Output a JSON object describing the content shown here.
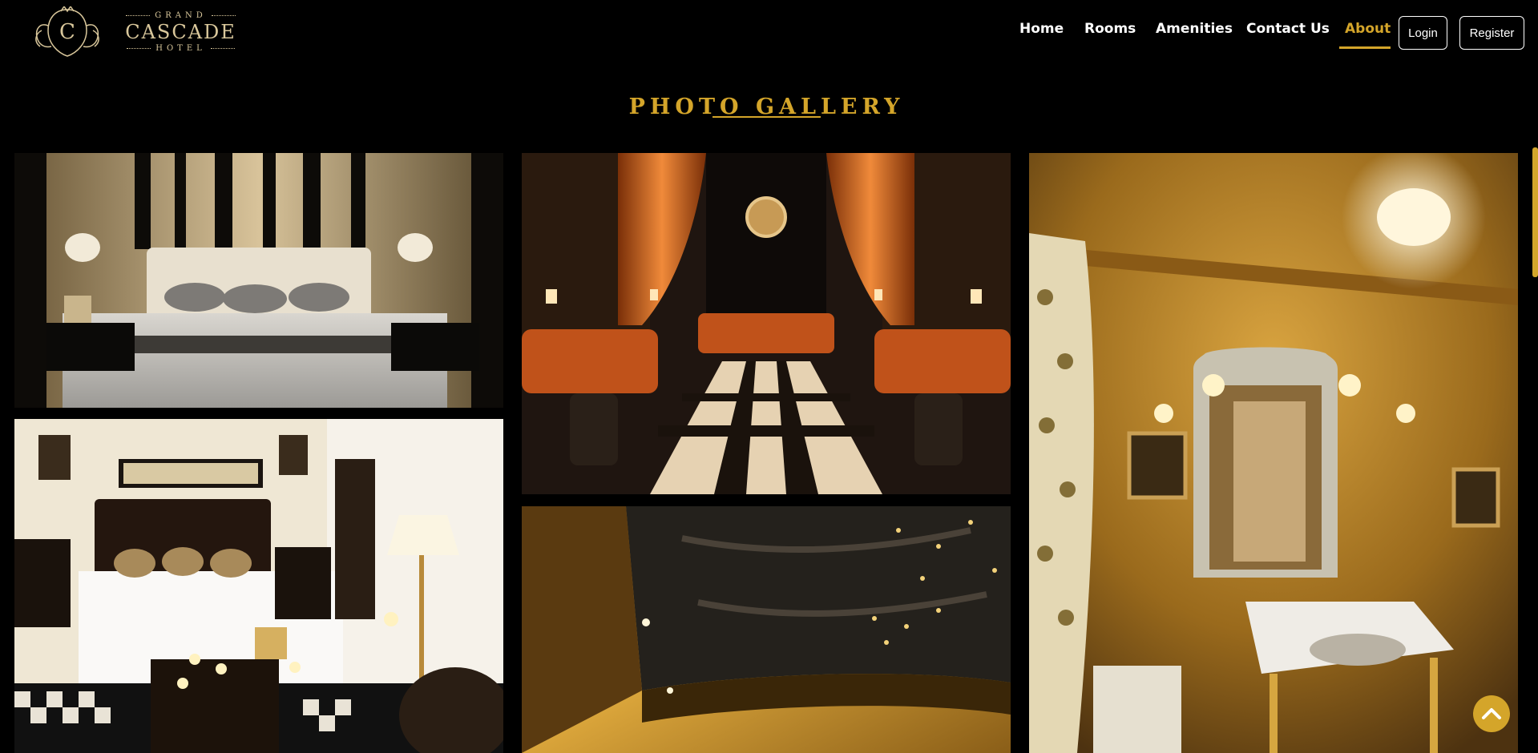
{
  "brand": {
    "top_line": "GRAND",
    "name": "CASCADE",
    "bottom_line": "HOTEL",
    "monogram": "C",
    "accent_color": "#d4a52a"
  },
  "nav": {
    "home": "Home",
    "rooms": "Rooms",
    "amenities": "Amenities",
    "contact": "Contact Us",
    "about": "About",
    "active": "About",
    "login": "Login",
    "register": "Register"
  },
  "gallery": {
    "title": "PHOTO GALLERY",
    "photos": [
      {
        "subject": "Suite bedroom with tufted headboard and striped gold wall"
      },
      {
        "subject": "Lobby lounge with orange drapes, zebra chairs and spiral staircase"
      },
      {
        "subject": "Powder room with gold fleur-de-lis wallpaper, ornate mirror and marble sink"
      },
      {
        "subject": "Bedroom with white bedding, candles and champagne bucket"
      },
      {
        "subject": "Ornate gold coffered ceiling with starry dome"
      }
    ]
  },
  "icons": {
    "back_to_top": "chevron-up-icon"
  }
}
